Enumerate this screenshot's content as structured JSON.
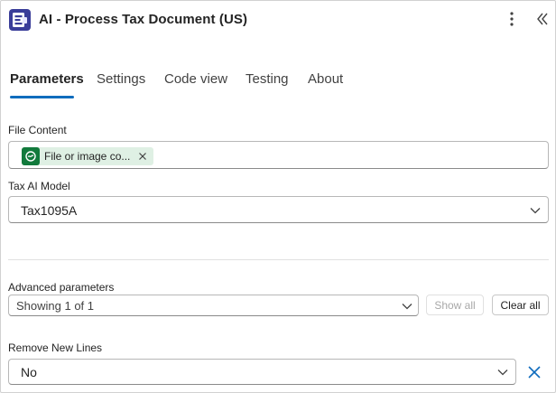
{
  "header": {
    "title": "AI - Process Tax Document (US)",
    "app_icon": "app-logo-icon",
    "more_icon": "more-vertical-icon",
    "collapse_icon": "double-chevron-left-icon"
  },
  "tabs": [
    {
      "label": "Parameters",
      "active": true
    },
    {
      "label": "Settings",
      "active": false
    },
    {
      "label": "Code view",
      "active": false
    },
    {
      "label": "Testing",
      "active": false
    },
    {
      "label": "About",
      "active": false
    }
  ],
  "file_content": {
    "label": "File Content",
    "chip_text": "File or image co...",
    "chip_icon": "ai-builder-icon"
  },
  "tax_model": {
    "label": "Tax AI Model",
    "value": "Tax1095A"
  },
  "advanced": {
    "label": "Advanced parameters",
    "value": "Showing 1 of 1",
    "show_all": "Show all",
    "clear_all": "Clear all"
  },
  "remove_new_lines": {
    "label": "Remove New Lines",
    "value": "No"
  },
  "colors": {
    "accent": "#0f6cbd",
    "chip_bg": "#dff0e4",
    "chip_icon_bg": "#127a3c",
    "app_icon_bg": "#3a3d99"
  }
}
